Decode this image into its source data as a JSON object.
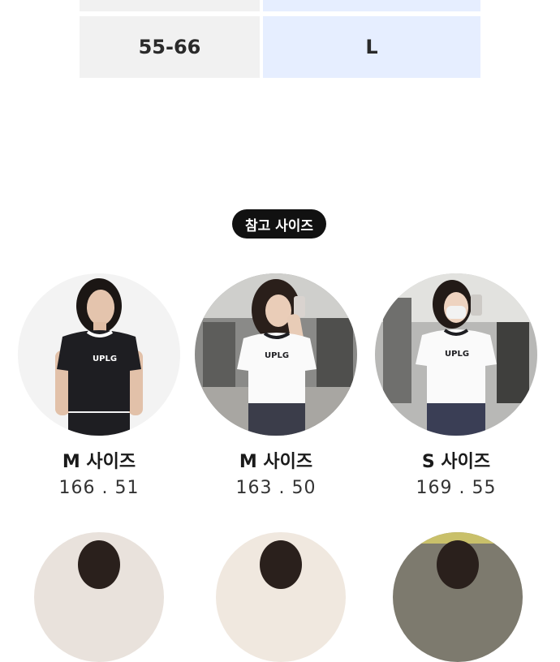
{
  "size_table": {
    "rows": [
      {
        "body_size": "",
        "shirt_size": ""
      },
      {
        "body_size": "55-66",
        "shirt_size": "L"
      }
    ]
  },
  "reference_badge": "참고 사이즈",
  "models": [
    {
      "size_label": "M 사이즈",
      "measurements": "166 . 51",
      "shirt_text": "UPLG",
      "shirt_color": "#1e1e22",
      "bg_color": "#f3f3f3"
    },
    {
      "size_label": "M 사이즈",
      "measurements": "163 . 50",
      "shirt_text": "UPLG",
      "shirt_color": "#fafafa",
      "bg_color": "#8a8a88"
    },
    {
      "size_label": "S 사이즈",
      "measurements": "169 . 55",
      "shirt_text": "UPLG",
      "shirt_color": "#fafafa",
      "bg_color": "#b8b8b6"
    }
  ]
}
